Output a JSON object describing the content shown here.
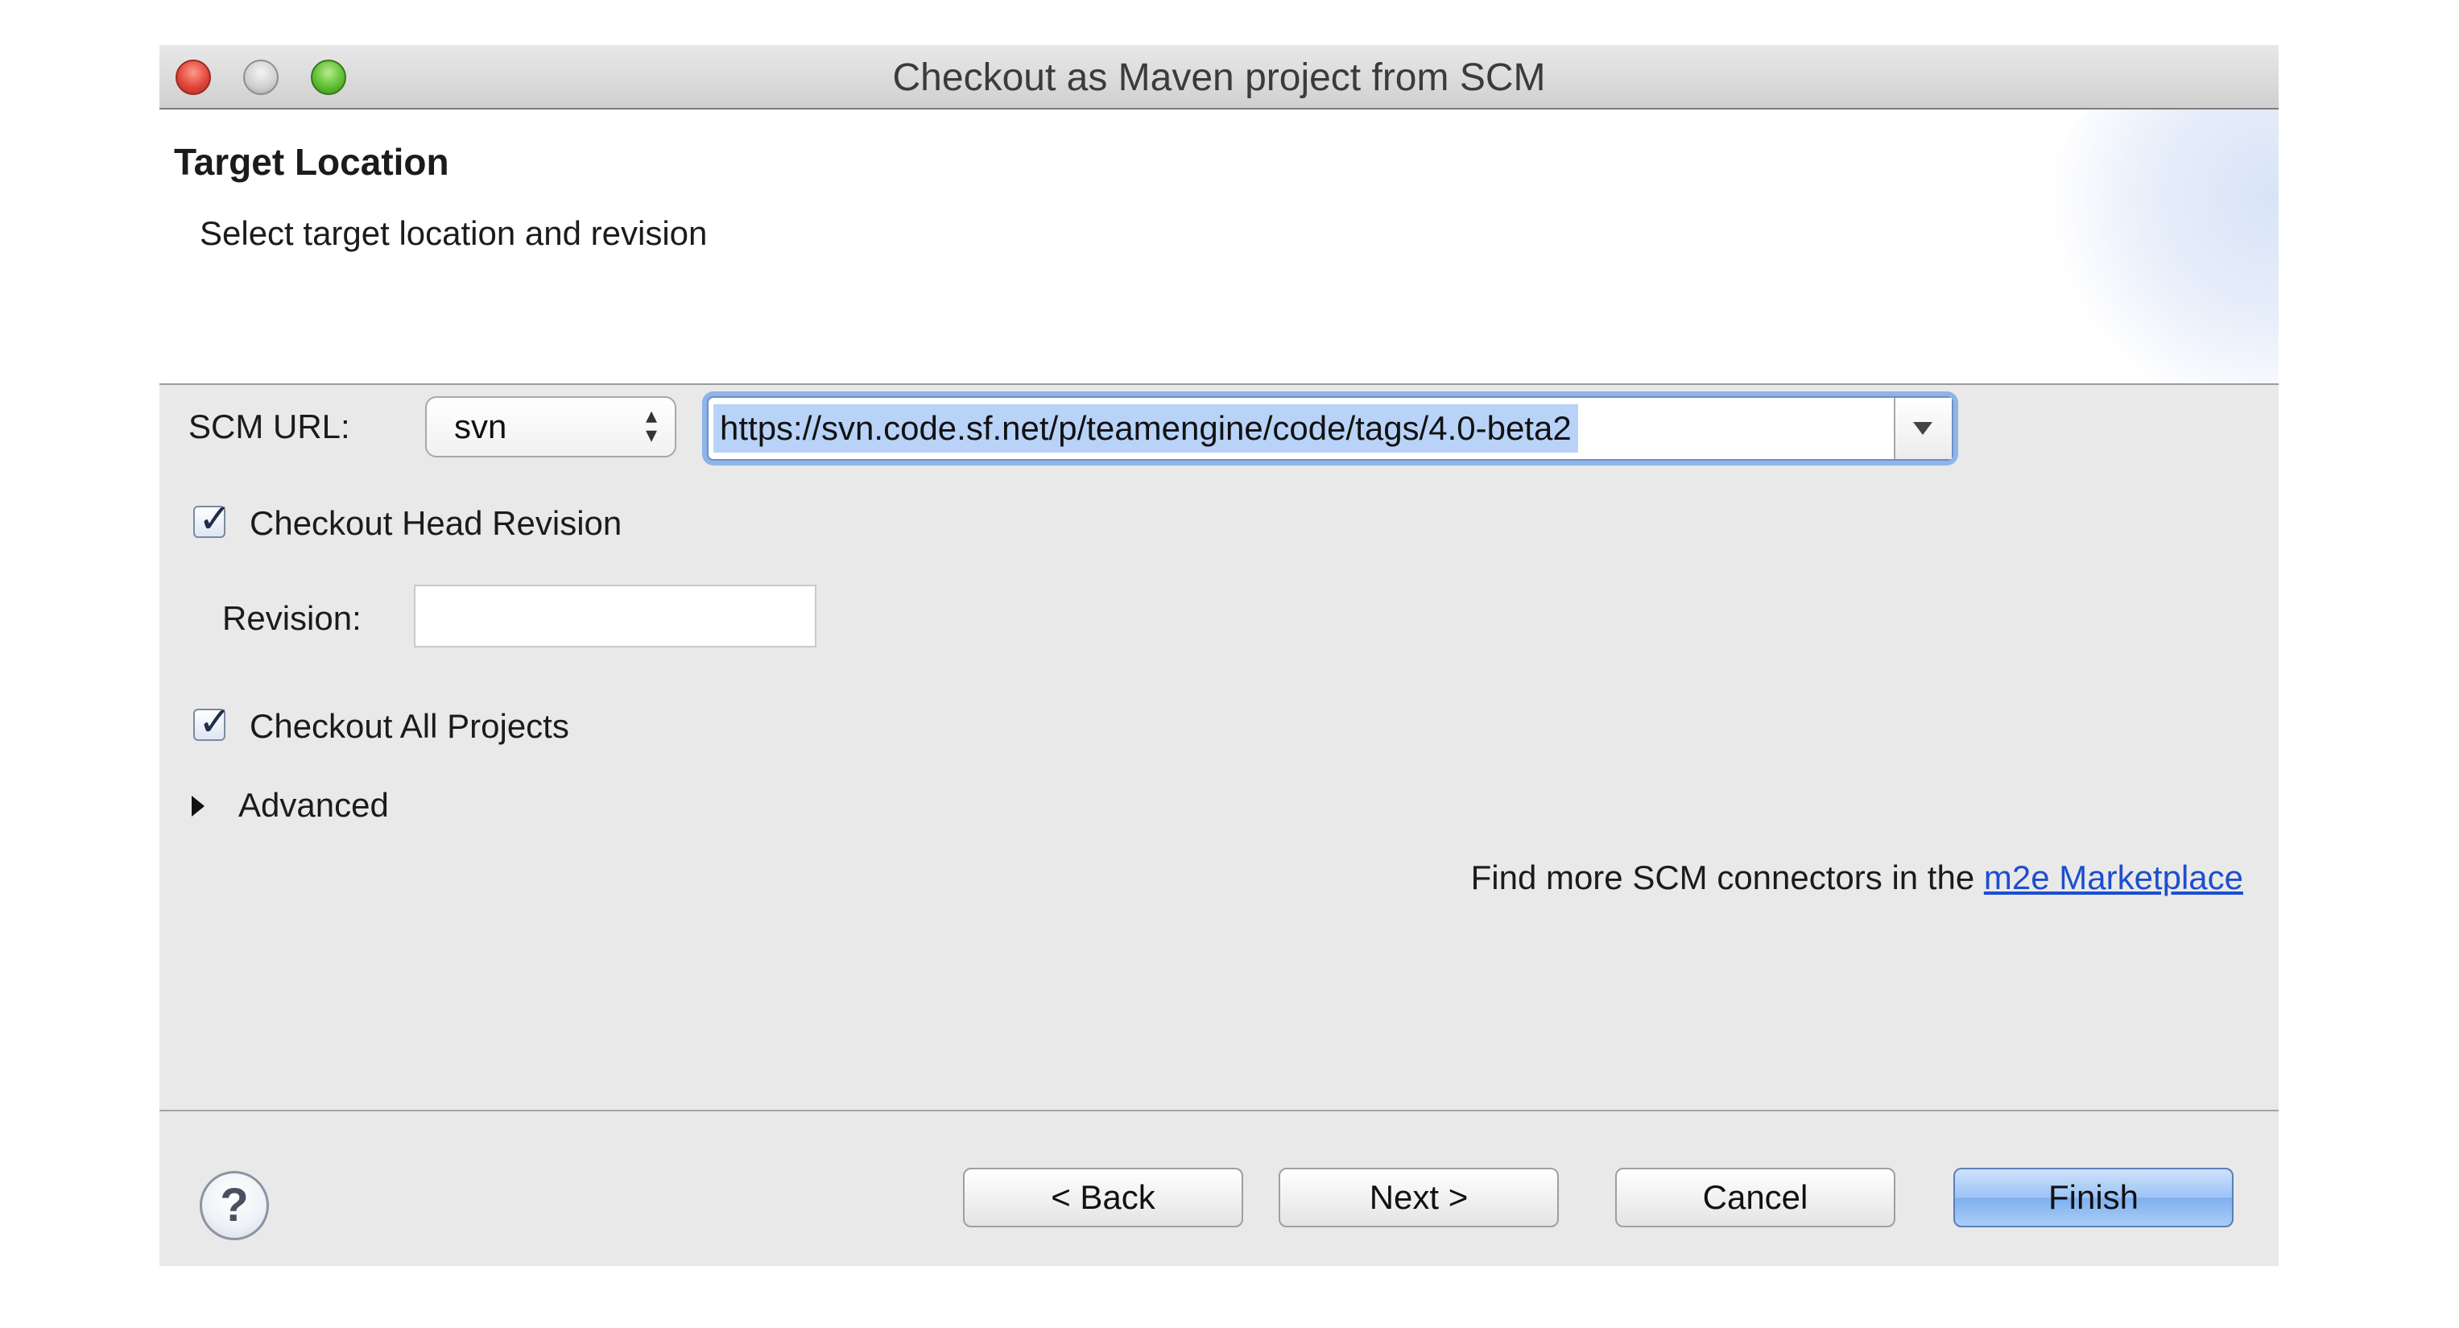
{
  "window": {
    "title": "Checkout as Maven project from SCM"
  },
  "banner": {
    "title": "Target Location",
    "description": "Select target location and revision"
  },
  "form": {
    "scm_url_label": "SCM URL:",
    "scm_type_value": "svn",
    "scm_url_value": "https://svn.code.sf.net/p/teamengine/code/tags/4.0-beta2",
    "checkout_head_label": "Checkout Head Revision",
    "checkout_head_checked": true,
    "revision_label": "Revision:",
    "revision_value": "",
    "checkout_all_label": "Checkout All Projects",
    "checkout_all_checked": true,
    "advanced_label": "Advanced",
    "marketplace_prefix": "Find more SCM connectors in the ",
    "marketplace_link": "m2e Marketplace"
  },
  "buttons": {
    "help": "?",
    "back": "< Back",
    "next": "Next >",
    "cancel": "Cancel",
    "finish": "Finish"
  },
  "colors": {
    "link": "#1d4ecf",
    "default_button": "#9cc3f5",
    "focus_ring": "#8fb4e8",
    "selection": "#b8d3f7"
  }
}
